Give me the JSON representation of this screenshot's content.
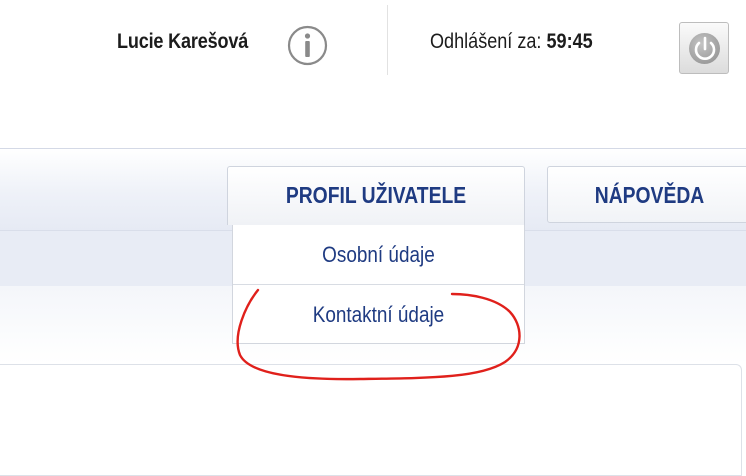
{
  "topbar": {
    "user_name": "Lucie Karešová",
    "info_icon": "info-circle-icon",
    "logout_label": "Odhlášení za:",
    "logout_timer": "59:45",
    "power_icon": "power-icon"
  },
  "nav": {
    "tabs": [
      {
        "label": "PROFIL UŽIVATELE"
      },
      {
        "label": "NÁPOVĚDA"
      }
    ],
    "profile_menu": [
      {
        "label": "Osobní údaje"
      },
      {
        "label": "Kontaktní údaje"
      }
    ]
  },
  "colors": {
    "nav_text": "#1f3b82",
    "annotation": "#e0201b"
  }
}
